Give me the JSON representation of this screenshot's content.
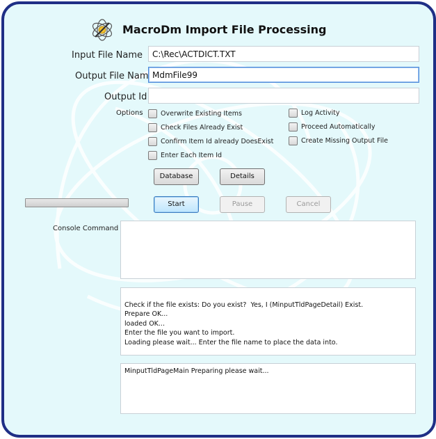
{
  "window": {
    "title": "MacroDm Import File Processing"
  },
  "fields": {
    "input_file": {
      "label": "Input File Name",
      "value": "C:\\Rec\\ACTDICT.TXT"
    },
    "output_file": {
      "label": "Output File Name",
      "value": "MdmFile99"
    },
    "output_id": {
      "label": "Output Id",
      "value": ""
    }
  },
  "options": {
    "label": "Options",
    "left": [
      {
        "label": "Overwrite Existing Items",
        "checked": false
      },
      {
        "label": "Check Files Already Exist",
        "checked": false
      },
      {
        "label": "Confirm Item Id already DoesExist",
        "checked": false
      },
      {
        "label": "Enter Each Item Id",
        "checked": false
      }
    ],
    "right": [
      {
        "label": "Log Activity",
        "checked": false
      },
      {
        "label": "Proceed Automatically",
        "checked": false
      },
      {
        "label": "Create Missing Output File",
        "checked": false
      }
    ]
  },
  "buttons": {
    "database": "Database",
    "details": "Details",
    "start": "Start",
    "pause": "Pause",
    "cancel": "Cancel"
  },
  "progress": {
    "value": 0
  },
  "console": {
    "label": "Console Command",
    "command": "",
    "output": "\nCheck if the file exists: Do you exist?  Yes, I (MinputTldPageDetail) Exist.\nPrepare OK...\nloaded OK...\nEnter the file you want to import.\nLoading please wait... Enter the file name to place the data into.",
    "status": "MinputTldPageMain Preparing please wait..."
  },
  "colors": {
    "frame_border": "#1f2f86",
    "background": "#e4f9fb",
    "watermark": "#ffffff"
  }
}
